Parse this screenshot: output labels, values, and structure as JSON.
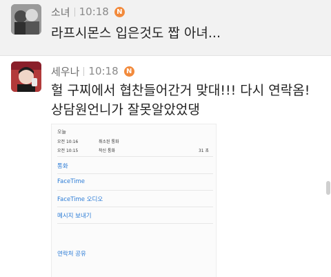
{
  "posts": [
    {
      "nickname": "소녀",
      "time": "10:18",
      "badge": "N",
      "message": "라프시몬스 입은것도 짭 아녀..."
    },
    {
      "nickname": "세우나",
      "time": "10:18",
      "badge": "N",
      "message_line1": "헐 구찌에서 협찬들어간거 맞대!!! 다시 연락옴!",
      "message_line2": "상담원언니가 잘못알았었댕",
      "attachment": {
        "section_title": "오늘",
        "calls": [
          {
            "time": "오전 10:16",
            "type": "취소된 통화",
            "duration": ""
          },
          {
            "time": "오전 10:15",
            "type": "착신 통화",
            "duration": "31 초"
          }
        ],
        "actions": [
          "통화",
          "FaceTime",
          "FaceTime 오디오",
          "메시지 보내기",
          "연락처 공유"
        ]
      }
    }
  ],
  "colors": {
    "badge": "#f28a3c",
    "link": "#2b7bd6",
    "post_background": "#f2f2f2"
  }
}
